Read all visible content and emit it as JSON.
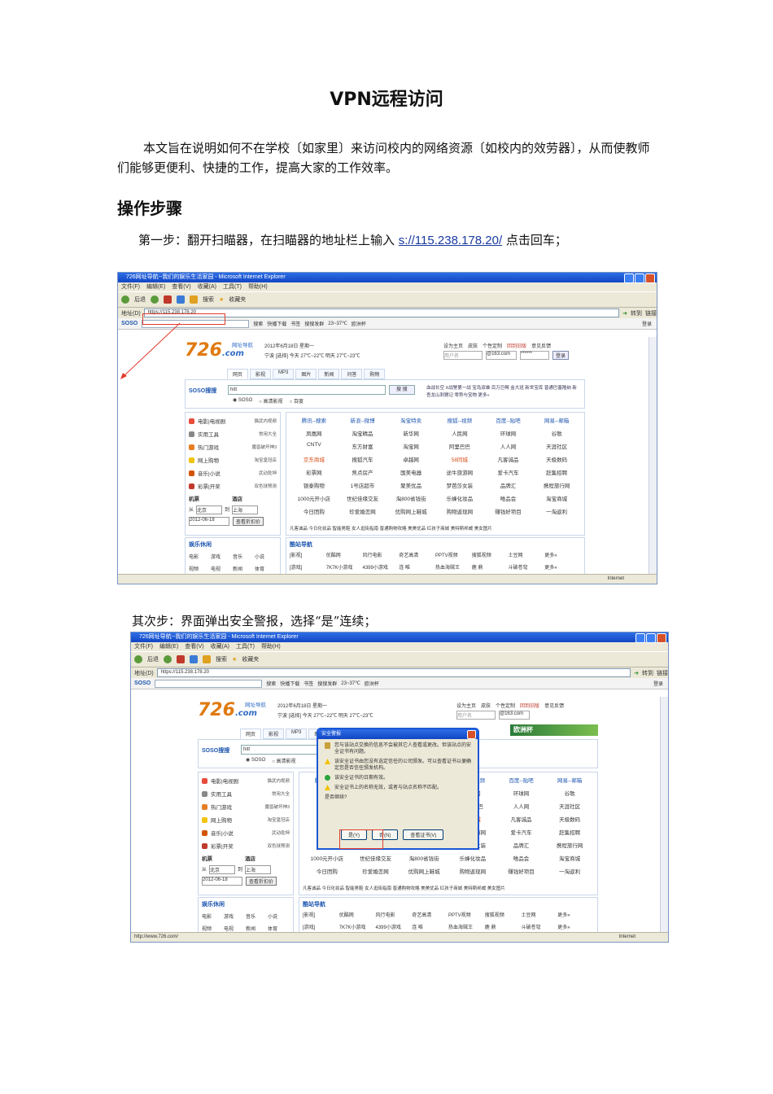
{
  "doc": {
    "title": "VPN远程访问",
    "intro": "本文旨在说明如何不在学校〔如家里〕来访问校内的网络资源〔如校内的效劳器〕，从而使教师们能够更便利、快捷的工作，提高大家的工作效率。",
    "section_heading": "操作步骤",
    "step1_prefix": "第一步：翻开扫瞄器，在扫瞄器的地址栏上输入",
    "step1_link": "s://115.238.178.20/",
    "step1_suffix": "点击回车；",
    "step2": "其次步：界面弹出安全警报，选择“是”连续；"
  },
  "browser": {
    "window_title": "726网址导航--我们的娱乐生活家园 - Microsoft Internet Explorer",
    "menu": [
      "文件(F)",
      "编辑(E)",
      "查看(V)",
      "收藏(A)",
      "工具(T)",
      "帮助(H)"
    ],
    "toolbar": [
      "后退",
      "搜索",
      "收藏夹"
    ],
    "address_label": "地址(D)",
    "address_value": "https://115.238.178.20",
    "go_label": "转到",
    "links_label": "链接",
    "soso_bar": {
      "brand": "SOSO",
      "search_button": "搜索",
      "items": [
        "快播下载",
        "书签",
        "搜搜发群",
        "23~37℃",
        "欧洲杯"
      ],
      "login": "登录"
    },
    "status_internet": "Internet",
    "status_url_2": "http://www.726.com/"
  },
  "site": {
    "logo": "726",
    "logo_suffix": ".com",
    "logo_tag": "网址导航",
    "date": "2012年6月18日 星期一",
    "weather_today": "宁波 [选择] 今天  27℃~22℃  明天  27℃~23℃",
    "header_links": [
      "设为主页",
      "皮肤",
      "个性定制",
      "回到旧版",
      "意见反馈"
    ],
    "username_placeholder": "用户名",
    "email_domain": "@163.com",
    "password_mask": "******",
    "login_button": "登录",
    "search_tabs": [
      "网页",
      "影视",
      "MP3",
      "图片",
      "新闻",
      "问答",
      "购物"
    ],
    "search_label": "SOSO搜搜",
    "search_value": "hitt",
    "search_button": "搜 搜",
    "search_options": [
      "SOSO",
      "高清影视",
      "百度"
    ],
    "hot_links": "血战长空 X战警第一战 宝岛双雄 百万巨鳄 金大班 新世宝库 普通巴塞隆纳 新吾龙山刺猬记 零势与宝物 更多»",
    "side_items": [
      {
        "label": "电影|电视剧",
        "sub": "猫武内视频"
      },
      {
        "label": "实用工具",
        "sub": "常用大全"
      },
      {
        "label": "热门游戏",
        "sub": "魔兽破坏神3"
      },
      {
        "label": "网上购物",
        "sub": "淘宝皇冠店"
      },
      {
        "label": "音乐|小说",
        "sub": "武动乾坤"
      },
      {
        "label": "彩票|开奖",
        "sub": "双色球预测"
      }
    ],
    "ticket": {
      "tab1": "机票",
      "tab2": "酒店",
      "from_label": "从",
      "from": "北京",
      "to_label": "到",
      "to": "上海",
      "date": "2012-06-18",
      "query": "查看折扣价"
    },
    "grid_rows": [
      [
        "腾讯--搜索",
        "新浪--微博",
        "淘宝特卖",
        "搜狐--视频",
        "百度--贴吧",
        "网易--邮箱"
      ],
      [
        "凤凰网",
        "淘宝精品",
        "新华网",
        "人民网",
        "环球网",
        "谷歌"
      ],
      [
        "CNTV",
        "东方财富",
        "淘宝网",
        "阿里巴巴",
        "人人网",
        "天涯社区"
      ],
      [
        "京东商城",
        "搜狐汽车",
        "卓越网",
        "58同城",
        "凡客诚品",
        "天极数码"
      ],
      [
        "彩票网",
        "焦点房产",
        "国美电器",
        "途牛旅游网",
        "爱卡汽车",
        "赶集招聘"
      ],
      [
        "银泰购物",
        "1号店超市",
        "聚美优品",
        "梦芭莎女装",
        "品牌汇",
        "携程旅行网"
      ],
      [
        "1000元开小店",
        "世纪佳缘交友",
        "淘800省钱街",
        "乐蜂化妆品",
        "唯品会",
        "淘宝商城"
      ],
      [
        "今日团购",
        "珍爱婚恋网",
        "优购网上鞋城",
        "购物返现网",
        "赚钱好项目",
        "一淘返利"
      ]
    ],
    "grid_bottom": "凡客诚品  今日化妆品  智能男鞋  女人逛街指南  普通购物攻略  美美优品  红孩子商城  美特斯邦威  美女图片",
    "ent_title": "娱乐休闲",
    "ent_items": [
      "电影",
      "游戏",
      "音乐",
      "小说",
      "视频",
      "电视",
      "新闻",
      "体育"
    ],
    "cool_title": "酷站导航",
    "cool_rows": [
      [
        "[影视]",
        "优酷网",
        "风行电影",
        "奇艺高清",
        "PPTV视频",
        "搜狐视频",
        "土豆网",
        "更多»"
      ],
      [
        "[游戏]",
        "7K7K小游戏",
        "4399小游戏",
        "连 唯",
        "热血海贼王",
        "鹿 鼎",
        "斗破苍穹",
        "更多»"
      ]
    ],
    "banner_right": "欧洲杯"
  },
  "dialog": {
    "title": "安全警报",
    "intro": "您与该站点交换的信息不会被其它人查看或更改。但该站点的安全证书有问题。",
    "items": [
      {
        "type": "warn",
        "text": "该安全证书由您没有选定信任的公司颁发。可以查看证书以便确定您是否信任颁发机构。"
      },
      {
        "type": "ok",
        "text": "该安全证书的日期有效。"
      },
      {
        "type": "warn",
        "text": "安全证书上的名称无效，或者与站点名称不匹配。"
      }
    ],
    "question": "是否继续?",
    "buttons": [
      "是(Y)",
      "否(N)",
      "查看证书(V)"
    ]
  }
}
